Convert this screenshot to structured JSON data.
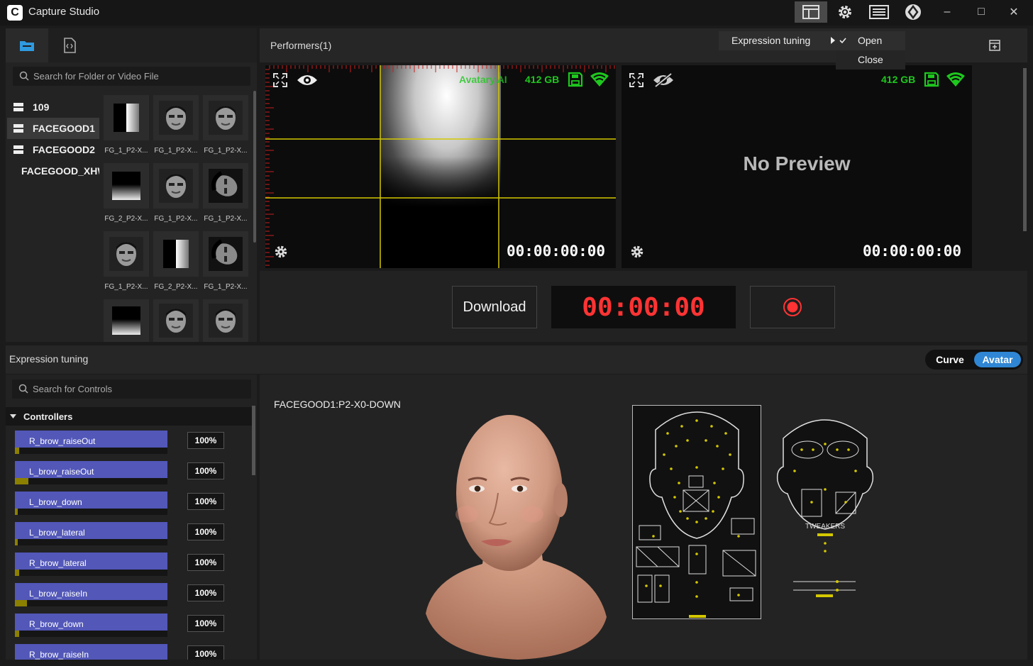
{
  "app": {
    "title": "Capture Studio",
    "logo_letter": "C"
  },
  "titlebar": {
    "icons": [
      "layout-icon",
      "gear-icon",
      "keyboard-icon",
      "brand-icon"
    ],
    "window_controls": {
      "minimize": "–",
      "maximize": "□",
      "close": "✕"
    }
  },
  "left_panel": {
    "tabs": [
      "folder-icon",
      "code-file-icon"
    ],
    "search_placeholder": "Search for Folder or Video File",
    "folders": [
      "109",
      "FACEGOOD1",
      "FACEGOOD2",
      "FACEGOOD_XHW"
    ],
    "selected_folder": "FACEGOOD1",
    "thumbnails": [
      "FG_1_P2-X...",
      "FG_1_P2-X...",
      "FG_1_P2-X...",
      "FG_2_P2-X...",
      "FG_1_P2-X...",
      "FG_1_P2-X...",
      "FG_1_P2-X...",
      "FG_2_P2-X...",
      "FG_1_P2-X...",
      "",
      "",
      ""
    ]
  },
  "performers": {
    "title": "Performers(1)",
    "preview1": {
      "overlay_label": "Avatary.AI",
      "storage": "412 GB",
      "timecode": "00:00:00:00"
    },
    "preview2": {
      "storage": "412 GB",
      "timecode": "00:00:00:00",
      "no_preview": "No Preview"
    }
  },
  "controls": {
    "download_label": "Download",
    "record_timer": "00:00:00"
  },
  "menu": {
    "item": "Expression tuning",
    "submenu": [
      {
        "label": "Open",
        "checked": true
      },
      {
        "label": "Close",
        "checked": false
      }
    ]
  },
  "expression": {
    "title": "Expression tuning",
    "toggle": {
      "curve": "Curve",
      "avatar": "Avatar",
      "active": "Avatar"
    },
    "search_placeholder": "Search for Controls",
    "controllers_label": "Controllers",
    "controllers": [
      {
        "name": "R_brow_raiseOut",
        "value": "100%",
        "level": 0.03
      },
      {
        "name": "L_brow_raiseOut",
        "value": "100%",
        "level": 0.09
      },
      {
        "name": "L_brow_down",
        "value": "100%",
        "level": 0.02
      },
      {
        "name": "L_brow_lateral",
        "value": "100%",
        "level": 0.02
      },
      {
        "name": "R_brow_lateral",
        "value": "100%",
        "level": 0.03
      },
      {
        "name": "L_brow_raiseIn",
        "value": "100%",
        "level": 0.08
      },
      {
        "name": "R_brow_down",
        "value": "100%",
        "level": 0.03
      },
      {
        "name": "R_brow_raiseIn",
        "value": "100%",
        "level": 0.03
      }
    ],
    "viewport_label": "FACEGOOD1:P2-X0-DOWN",
    "rig_labels": {
      "tweakers": "TWEAKERS"
    }
  },
  "colors": {
    "accent_blue": "#2f86d4",
    "storage_green": "#1ec81e",
    "record_red": "#ff3333",
    "controller_bar": "#5257b8"
  }
}
